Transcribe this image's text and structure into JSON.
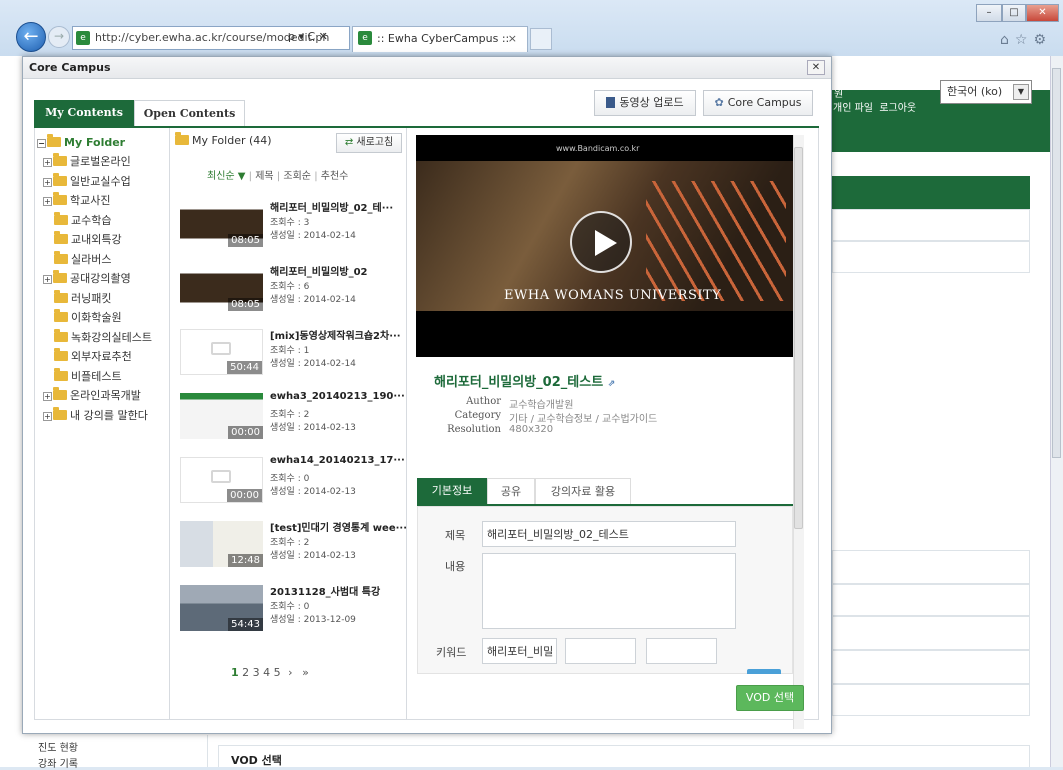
{
  "browser": {
    "url": "http://cyber.ewha.ac.kr/course/modedit.ph",
    "url_controls": "ρ ▾ C ✕",
    "tab_title": ":: Ewha CyberCampus ::"
  },
  "background_page": {
    "user_links": "개인 파일  로그아웃",
    "user_link_partial": "원",
    "language_select": "한국어 (ko)",
    "left_items": [
      "진도 현황",
      "강좌 기록"
    ],
    "vod_select_heading": "VOD 선택"
  },
  "modal": {
    "title": "Core Campus",
    "tabs": [
      "My Contents",
      "Open Contents"
    ],
    "upload_button": "동영상 업로드",
    "core_campus_button": "Core Campus",
    "tree": {
      "root": "My Folder",
      "items": [
        {
          "label": "글로벌온라인",
          "expandable": true
        },
        {
          "label": "일반교실수업",
          "expandable": true
        },
        {
          "label": "학교사진",
          "expandable": true
        },
        {
          "label": "교수학습",
          "expandable": false
        },
        {
          "label": "교내외특강",
          "expandable": false
        },
        {
          "label": "실라버스",
          "expandable": false
        },
        {
          "label": "공대강의촬영",
          "expandable": true
        },
        {
          "label": "러닝패킷",
          "expandable": false
        },
        {
          "label": "이화학술원",
          "expandable": false
        },
        {
          "label": "녹화강의실테스트",
          "expandable": false
        },
        {
          "label": "외부자료추천",
          "expandable": false
        },
        {
          "label": "비플테스트",
          "expandable": false
        },
        {
          "label": "온라인과목개발",
          "expandable": true
        },
        {
          "label": "내 강의를 말한다",
          "expandable": true
        }
      ]
    },
    "list": {
      "folder_label": "My Folder (44)",
      "refresh_button": "새로고침",
      "sort_options": [
        "최신순 ▼",
        "제목",
        "조회순",
        "추천수"
      ],
      "videos": [
        {
          "title": "해리포터_비밀의방_02_테···",
          "views": "조회수 : 3",
          "date": "생성일 : 2014-02-14",
          "duration": "08:05",
          "thumb": "dark"
        },
        {
          "title": "해리포터_비밀의방_02",
          "views": "조회수 : 6",
          "date": "생성일 : 2014-02-14",
          "duration": "08:05",
          "thumb": "dark"
        },
        {
          "title": "[mix]동영상제작워크숍2차···",
          "views": "조회수 : 1",
          "date": "생성일 : 2014-02-14",
          "duration": "50:44",
          "thumb": "blank"
        },
        {
          "title": "ewha3_20140213_190···",
          "views": "조회수 : 2",
          "date": "생성일 : 2014-02-13",
          "duration": "00:00",
          "thumb": "screen"
        },
        {
          "title": "ewha14_20140213_17···",
          "views": "조회수 : 0",
          "date": "생성일 : 2014-02-13",
          "duration": "00:00",
          "thumb": "blank"
        },
        {
          "title": "[test]민대기 경영통계 wee···",
          "views": "조회수 : 2",
          "date": "생성일 : 2014-02-13",
          "duration": "12:48",
          "thumb": "lecture"
        },
        {
          "title": "20131128_사범대 특강",
          "views": "조회수 : 0",
          "date": "생성일 : 2013-12-09",
          "duration": "54:43",
          "thumb": "hall"
        }
      ],
      "pagination": [
        "1",
        "2",
        "3",
        "4",
        "5",
        "›",
        "»"
      ]
    },
    "detail": {
      "video_watermark": "www.Bandicam.co.kr",
      "video_caption": "EWHA WOMANS UNIVERSITY",
      "title": "해리포터_비밀의방_02_테스트",
      "meta": [
        {
          "label": "Author",
          "value": "교수학습개발원"
        },
        {
          "label": "Category",
          "value": "기타 / 교수학습정보 / 교수법가이드"
        },
        {
          "label": "Resolution",
          "value": "480x320"
        }
      ],
      "tabs": [
        "기본정보",
        "공유",
        "강의자료 활용"
      ],
      "form": {
        "title_label": "제목",
        "title_value": "해리포터_비밀의방_02_테스트",
        "content_label": "내용",
        "keyword_label": "키워드",
        "keyword_value": "해리포터_비밀"
      }
    },
    "vod_select_button": "VOD 선택"
  }
}
